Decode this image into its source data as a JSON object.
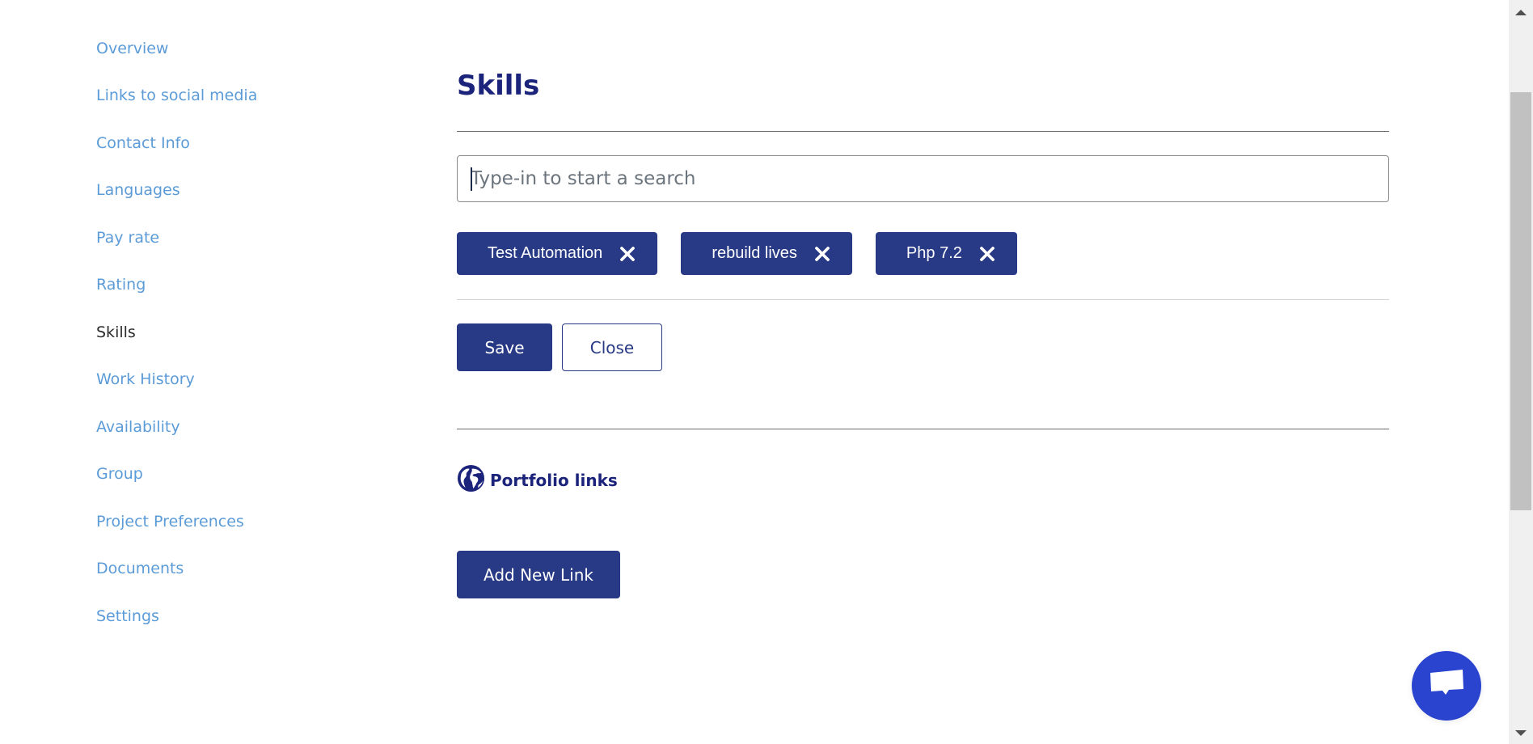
{
  "sidebar": {
    "items": [
      {
        "label": "Overview",
        "active": false
      },
      {
        "label": "Links to social media",
        "active": false
      },
      {
        "label": "Contact Info",
        "active": false
      },
      {
        "label": "Languages",
        "active": false
      },
      {
        "label": "Pay rate",
        "active": false
      },
      {
        "label": "Rating",
        "active": false
      },
      {
        "label": "Skills",
        "active": true
      },
      {
        "label": "Work History",
        "active": false
      },
      {
        "label": "Availability",
        "active": false
      },
      {
        "label": "Group",
        "active": false
      },
      {
        "label": "Project Preferences",
        "active": false
      },
      {
        "label": "Documents",
        "active": false
      },
      {
        "label": "Settings",
        "active": false
      }
    ]
  },
  "skills": {
    "title": "Skills",
    "search": {
      "value": "",
      "placeholder": "Type-in to start a search"
    },
    "chips": [
      {
        "label": "Test Automation",
        "remove_icon": "close-icon"
      },
      {
        "label": "rebuild lives",
        "remove_icon": "close-icon"
      },
      {
        "label": "Php 7.2",
        "remove_icon": "close-icon"
      }
    ],
    "save_label": "Save",
    "close_label": "Close"
  },
  "portfolio": {
    "icon": "globe-icon",
    "label": "Portfolio links",
    "add_link_label": "Add New Link"
  },
  "chat": {
    "icon": "chat-bubble-icon"
  },
  "colors": {
    "primary": "#283a85",
    "heading": "#1b237a",
    "sidebar_link": "#5b9bd8",
    "sidebar_active": "#2b2b2b",
    "chat": "#2a44cf"
  }
}
